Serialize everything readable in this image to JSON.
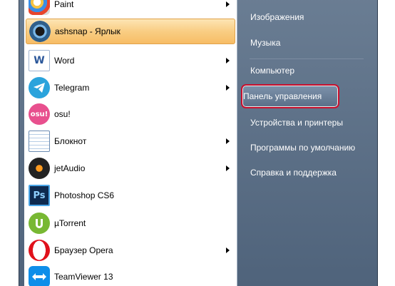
{
  "programs": [
    {
      "label": "Paint",
      "icon": "paint-icon",
      "has_arrow": true
    },
    {
      "label": "ashsnap - Ярлык",
      "icon": "ashsnap-icon",
      "has_arrow": false,
      "highlighted": true
    },
    {
      "label": "Word",
      "icon": "word-icon",
      "has_arrow": true
    },
    {
      "label": "Telegram",
      "icon": "telegram-icon",
      "has_arrow": true
    },
    {
      "label": "osu!",
      "icon": "osu-icon",
      "has_arrow": false,
      "icon_text": "osu!"
    },
    {
      "label": "Блокнот",
      "icon": "notepad-icon",
      "has_arrow": true
    },
    {
      "label": "jetAudio",
      "icon": "jetaudio-icon",
      "has_arrow": true
    },
    {
      "label": "Photoshop CS6",
      "icon": "photoshop-icon",
      "has_arrow": false,
      "icon_text": "Ps"
    },
    {
      "label": "µTorrent",
      "icon": "utorrent-icon",
      "has_arrow": false
    },
    {
      "label": "Браузер Opera",
      "icon": "opera-icon",
      "has_arrow": true
    },
    {
      "label": "TeamViewer 13",
      "icon": "teamviewer-icon",
      "has_arrow": false
    }
  ],
  "right_menu": [
    {
      "label": "Изображения"
    },
    {
      "label": "Музыка"
    },
    {
      "label": "Компьютер"
    },
    {
      "label": "Панель управления",
      "highlighted": true
    },
    {
      "label": "Устройства и принтеры"
    },
    {
      "label": "Программы по умолчанию"
    },
    {
      "label": "Справка и поддержка"
    }
  ]
}
